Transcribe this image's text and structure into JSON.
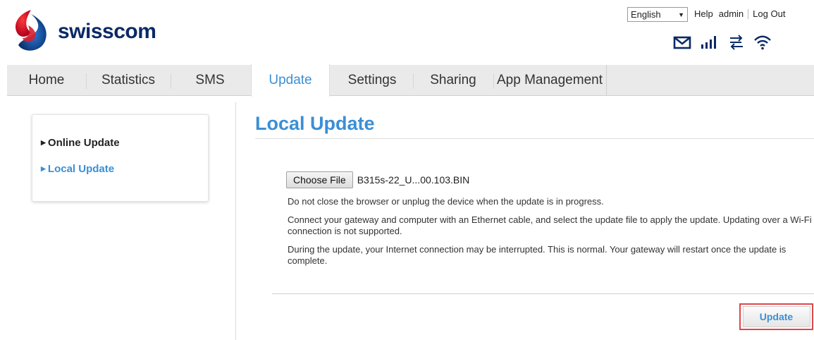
{
  "brand": {
    "name": "swisscom"
  },
  "top_bar": {
    "language": "English",
    "help": "Help",
    "user": "admin",
    "logout": "Log Out"
  },
  "status": {
    "icons": [
      "mail-icon",
      "signal-strength-icon",
      "data-transfer-icon",
      "wifi-icon"
    ]
  },
  "nav": {
    "tabs": [
      {
        "label": "Home"
      },
      {
        "label": "Statistics"
      },
      {
        "label": "SMS"
      },
      {
        "label": "Update",
        "active": true
      },
      {
        "label": "Settings"
      },
      {
        "label": "Sharing"
      },
      {
        "label": "App Management"
      }
    ]
  },
  "sidebar": {
    "items": [
      {
        "label": "Online Update"
      },
      {
        "label": "Local Update",
        "active": true
      }
    ]
  },
  "main": {
    "title": "Local Update",
    "choose_file_label": "Choose File",
    "file_name": "B315s-22_U...00.103.BIN",
    "paragraphs": [
      "Do not close the browser or unplug the device when the update is in progress.",
      "Connect your gateway and computer with an Ethernet cable, and select the update file to apply the update. Updating over a Wi-Fi connection is not supported.",
      "During the update, your Internet connection may be interrupted. This is normal. Your gateway will restart once the update is complete."
    ],
    "update_label": "Update"
  },
  "colors": {
    "accent": "#3a8fd6",
    "brand_navy": "#0a2a66",
    "highlight_border": "#e0464a",
    "nav_bg": "#eaeaea"
  }
}
